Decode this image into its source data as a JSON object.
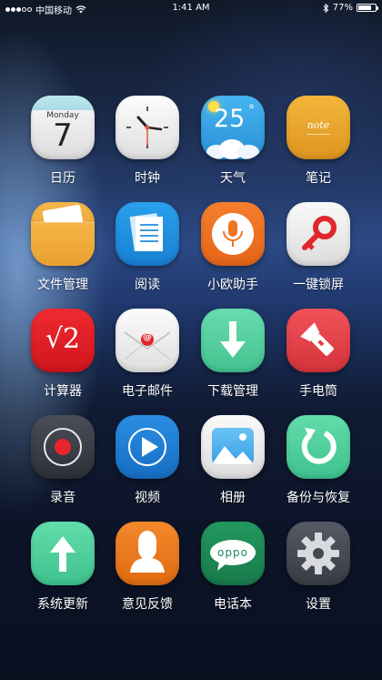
{
  "status_bar": {
    "signal_dots_filled": 3,
    "signal_dots_total": 5,
    "carrier": "中国移动",
    "time": "1:41 AM",
    "battery_percent_label": "77%",
    "battery_level": 0.77
  },
  "icon_text": {
    "calendar_day": "Monday",
    "calendar_date": "7",
    "weather_temp": "25",
    "weather_degree": "°",
    "notes_script": "note",
    "calculator_symbol": "√2",
    "email_at": "@",
    "dialer_brand": "oppo"
  },
  "apps": [
    {
      "label": "日历"
    },
    {
      "label": "时钟"
    },
    {
      "label": "天气"
    },
    {
      "label": "笔记"
    },
    {
      "label": "文件管理"
    },
    {
      "label": "阅读"
    },
    {
      "label": "小欧助手"
    },
    {
      "label": "一键锁屏"
    },
    {
      "label": "计算器"
    },
    {
      "label": "电子邮件"
    },
    {
      "label": "下载管理"
    },
    {
      "label": "手电筒"
    },
    {
      "label": "录音"
    },
    {
      "label": "视频"
    },
    {
      "label": "相册"
    },
    {
      "label": "备份与恢复"
    },
    {
      "label": "系统更新"
    },
    {
      "label": "意见反馈"
    },
    {
      "label": "电话本"
    },
    {
      "label": "设置"
    }
  ],
  "colors": {
    "weather_blue": "#3aa6e8",
    "notes_orange": "#e8a22a",
    "files_orange": "#eba43a",
    "reader_blue": "#1d8fe0",
    "assistant_orange": "#ee7322",
    "calculator_red": "#e01d24",
    "download_green": "#55d0a0",
    "flashlight_red": "#e6414a",
    "recorder_dark": "#3c3f48",
    "video_blue": "#1e7ed6",
    "backup_green": "#4ccf9d",
    "update_green": "#4ccf9d",
    "feedback_orange": "#ef7b1e",
    "contacts_green": "#1e8a5a",
    "settings_gray": "#4a4e58"
  }
}
